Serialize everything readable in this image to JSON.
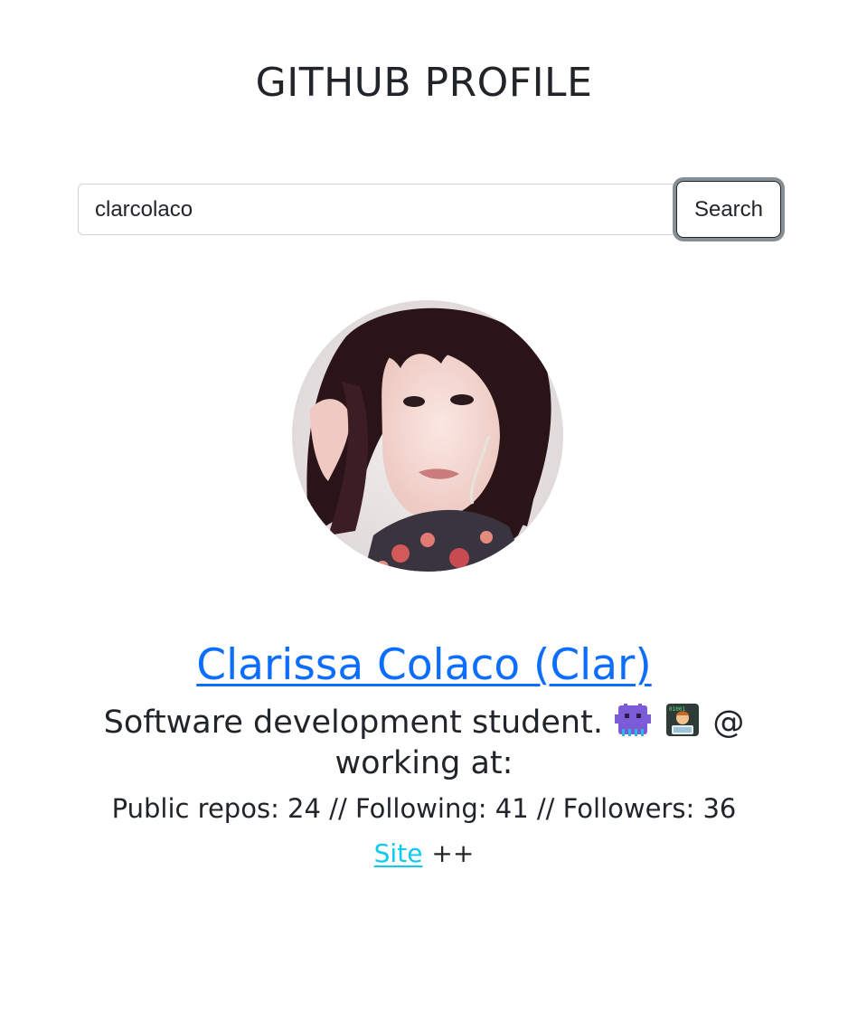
{
  "page": {
    "title": "GITHUB PROFILE"
  },
  "search": {
    "value": "clarcolaco",
    "button_label": "Search"
  },
  "profile": {
    "name": "Clarissa Colaco (Clar)",
    "bio_text": "Software development student.",
    "bio_emojis": [
      "space-invader-emoji",
      "technologist-emoji"
    ],
    "bio_suffix": "@",
    "bio_line2": "working at:",
    "stats": "Public repos: 24 // Following: 41 // Followers: 36",
    "site_label": "Site",
    "site_suffix": "++"
  },
  "colors": {
    "link": "#0d6efd",
    "site_link": "#0dcaf0",
    "text": "#212529"
  }
}
